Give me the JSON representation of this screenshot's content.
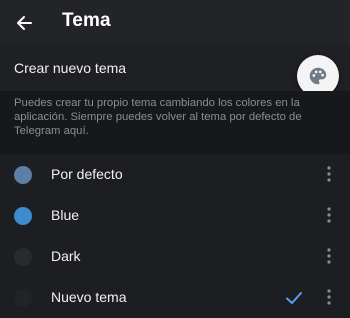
{
  "header": {
    "title": "Tema",
    "back_icon": "arrow-left-icon"
  },
  "create_theme": {
    "label": "Crear nuevo tema",
    "fab_icon": "palette-icon"
  },
  "info": {
    "text": "Puedes crear tu propio tema cambiando los colores en la aplicación. Siempre puedes volver al tema por defecto de Telegram aquí."
  },
  "themes": [
    {
      "name": "Por defecto",
      "color": "#5b7fa5",
      "selected": false
    },
    {
      "name": "Blue",
      "color": "#3c8bcc",
      "selected": false
    },
    {
      "name": "Dark",
      "color": "#2a2b2f",
      "selected": false
    },
    {
      "name": "Nuevo tema",
      "color": "#222327",
      "selected": true
    }
  ],
  "colors": {
    "accent": "#4ea4f6",
    "background": "#1d1e22",
    "header": "#232428",
    "info_background": "#17181b"
  }
}
